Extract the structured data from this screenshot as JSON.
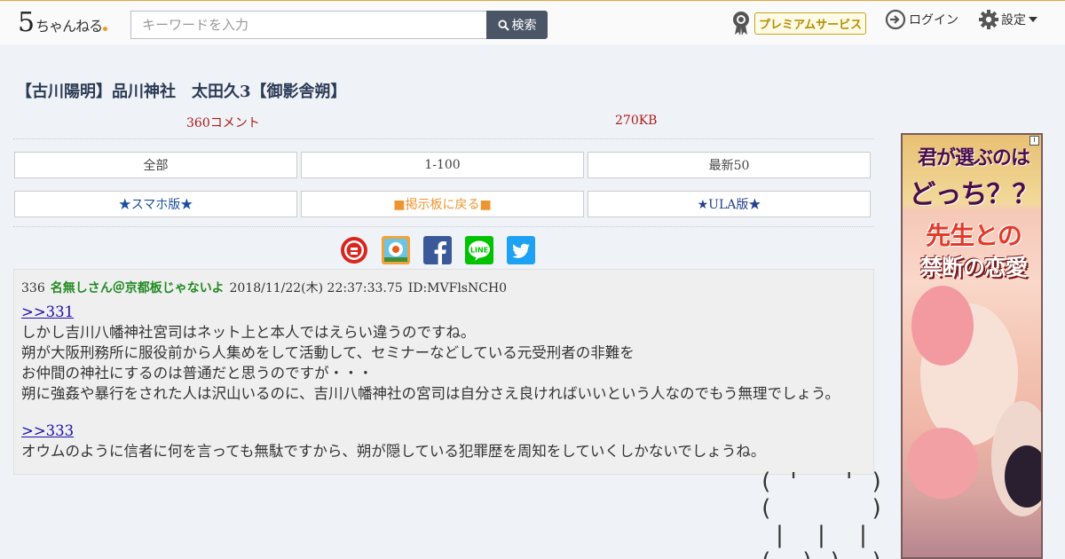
{
  "header": {
    "logo_num": "5",
    "logo_text": "ちゃんねる",
    "search_placeholder": "キーワードを入力",
    "search_button": "検索",
    "premium_label": "プレミアムサービス",
    "login_label": "ログイン",
    "settings_label": "設定"
  },
  "thread": {
    "title": "【古川陽明】品川神社　太田久3【御影舎朔】",
    "comments": "360コメント",
    "size": "270KB"
  },
  "nav": {
    "all": "全部",
    "range": "1-100",
    "latest": "最新50",
    "smartphone": "★スマホ版★",
    "back_to_board": "■掲示板に戻る■",
    "ula": "★ULA版★"
  },
  "share": {
    "icons": [
      "matome-icon",
      "bookmark-icon",
      "facebook-icon",
      "line-icon",
      "twitter-icon"
    ],
    "colors": {
      "facebook": "#3b5998",
      "line": "#00c300",
      "twitter": "#1da1f2",
      "matome": "#d9261c"
    }
  },
  "post": {
    "number": "336",
    "name": "名無しさん＠京都板じゃないよ",
    "date": "2018/11/22(木) 22:37:33.75",
    "id": "ID:MVFlsNCH0",
    "anchor1": ">>331",
    "line1": "しかし吉川八幡神社宮司はネット上と本人ではえらい違うのですね。",
    "line2": "朔が大阪刑務所に服役前から人集めをして活動して、セミナーなどしている元受刑者の非難を",
    "line3": "お仲間の神社にするのは普通だと思うのですが・・・",
    "line4": "朔に強姦や暴行をされた人は沢山いるのに、吉川八幡神社の宮司は自分さえ良ければいいという人なのでもう無理でしょう。",
    "anchor2": ">>333",
    "line5": "オウムのように信者に何を言っても無駄ですから、朔が隠している犯罪歴を周知をしていくしかないでしょうね。"
  },
  "ascii_art": "( '   ' )\n(       )\n |  |  |\n(__)_)__)",
  "ad": {
    "line1": "君が選ぶのは",
    "line2": "どっち？？",
    "line3": "先生との",
    "line4": "禁断の恋愛",
    "info": "i"
  }
}
